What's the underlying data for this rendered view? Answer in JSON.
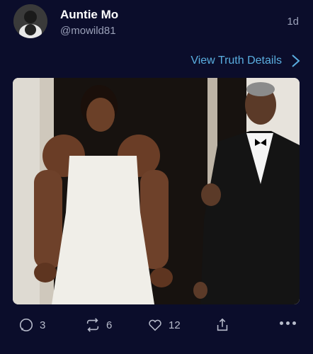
{
  "post": {
    "author_name": "Auntie Mo",
    "handle": "@mowild81",
    "time_ago": "1d",
    "details_link": "View Truth Details"
  },
  "media": {
    "description_icon": "photo"
  },
  "actions": {
    "replies": "3",
    "retruths": "6",
    "likes": "12"
  },
  "colors": {
    "background": "#0b0d2b",
    "accent": "#5aaee0",
    "muted": "#9aa0b8"
  }
}
